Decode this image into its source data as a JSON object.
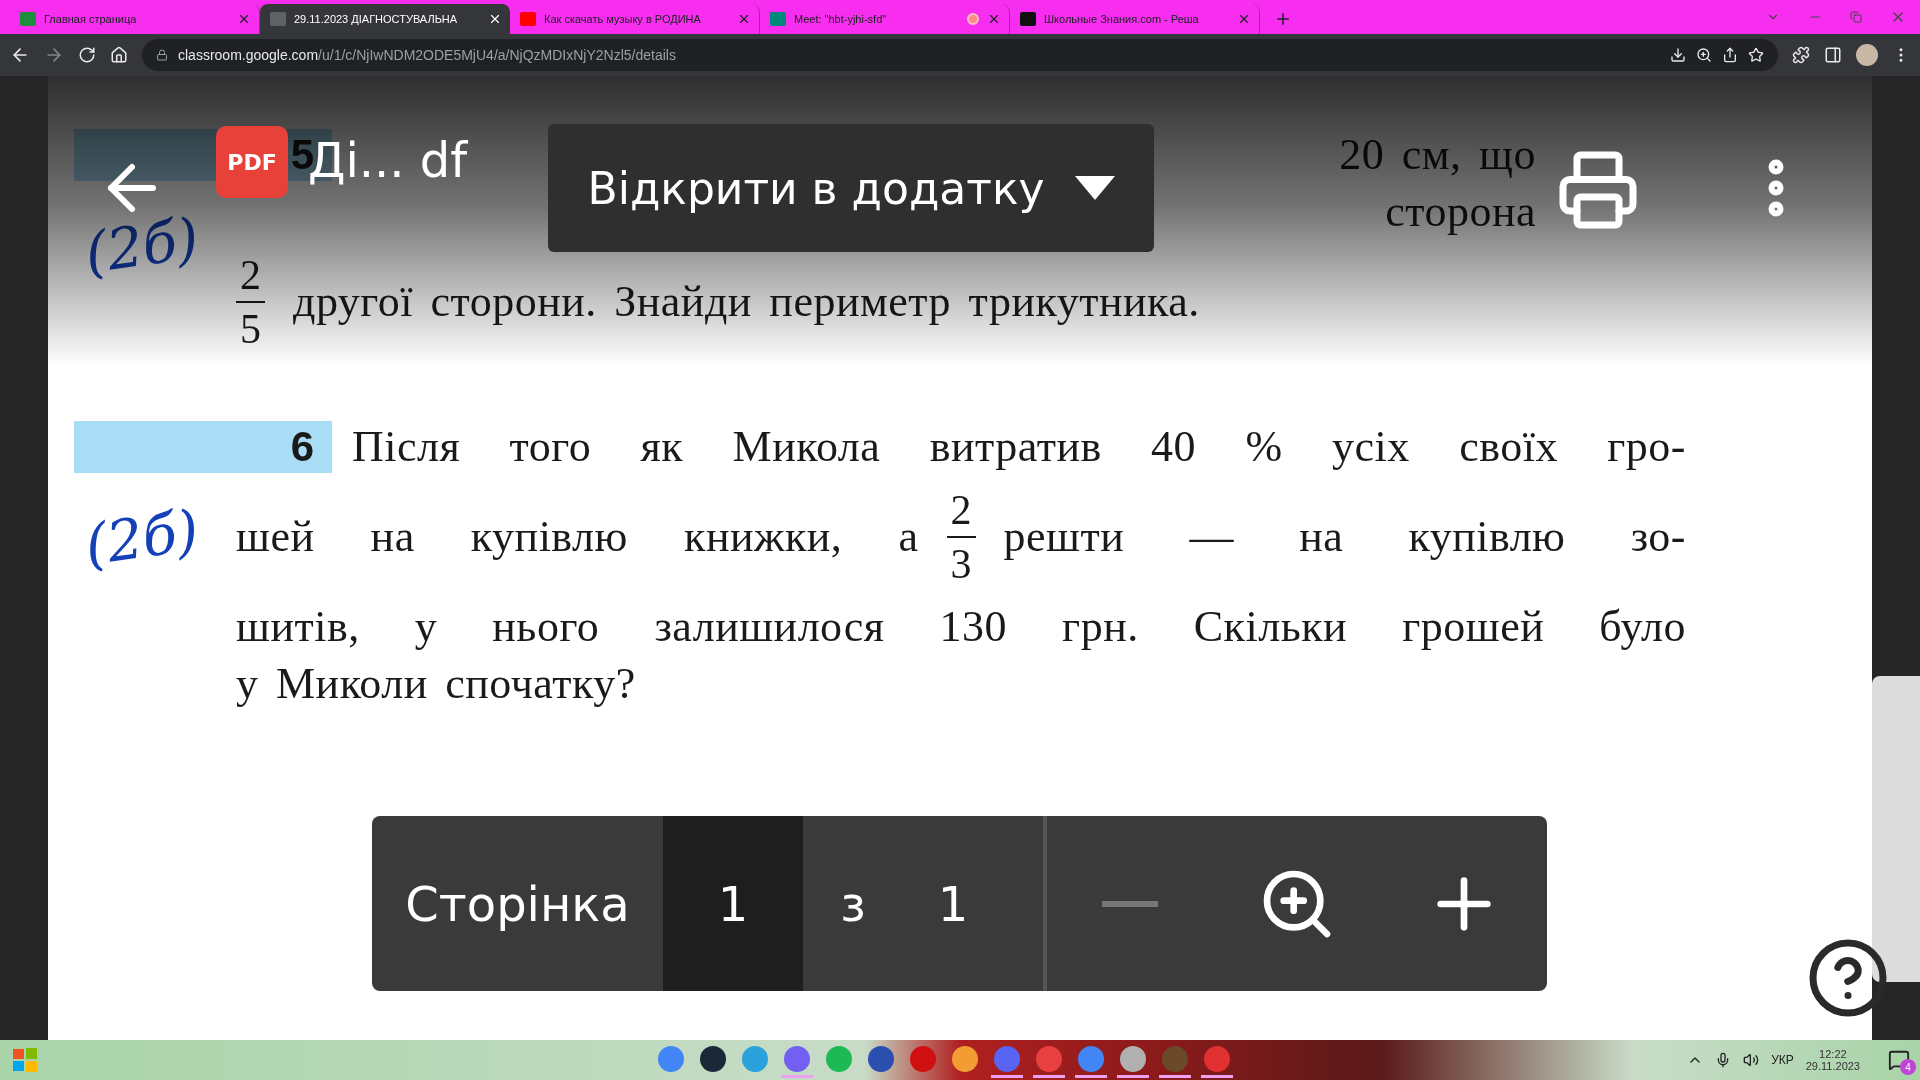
{
  "browser": {
    "tabs": [
      {
        "title": "Главная страница",
        "kind": "classroom",
        "selected": false,
        "recording": false
      },
      {
        "title": "29.11.2023 ДІАГНОСТУВАЛЬНА",
        "kind": "assignment",
        "selected": true,
        "recording": false
      },
      {
        "title": "Как скачать музыку в РОДИНА",
        "kind": "video",
        "selected": false,
        "recording": false
      },
      {
        "title": "Meet: \"hbt-yjhi-sfd\"",
        "kind": "meet",
        "selected": false,
        "recording": true
      },
      {
        "title": "Школьные Знания.com - Реша",
        "kind": "letter",
        "selected": false,
        "recording": false
      }
    ],
    "address": {
      "domain": "classroom.google.com",
      "path": "/u/1/c/NjIwNDM2ODE5MjU4/a/NjQzMDIxNjY2Nzl5/details"
    }
  },
  "viewer": {
    "file_badge": "PDF",
    "file_name": "Ді... df",
    "open_button": "Відкрити в додатку",
    "page_label": "Сторінка",
    "page_current": "1",
    "page_separator": "з",
    "page_total": "1"
  },
  "problems": [
    {
      "number": "5",
      "score_note": "(2б)",
      "lines": [
        [
          {
            "kind": "fragment",
            "text": "20 см, що"
          }
        ],
        [
          {
            "kind": "fragment",
            "text": "сторона"
          }
        ],
        [
          {
            "kind": "fraction",
            "num": "2",
            "den": "5"
          },
          {
            "kind": "text",
            "text": "другої сторони. Знайди периметр трикутника."
          }
        ]
      ]
    },
    {
      "number": "6",
      "score_note": "(2б)",
      "lines": [
        [
          {
            "kind": "text",
            "text": "Після того як Микола витратив 40 % усіх своїх гро-"
          }
        ],
        [
          {
            "kind": "text",
            "text": "шей на купівлю книжки, а"
          },
          {
            "kind": "fraction",
            "num": "2",
            "den": "3"
          },
          {
            "kind": "text",
            "text": "решти — на купівлю зо-"
          }
        ],
        [
          {
            "kind": "text",
            "text": "шитів, у нього залишилося 130 грн. Скільки грошей було"
          }
        ],
        [
          {
            "kind": "text",
            "text": "у Миколи спочатку?"
          }
        ]
      ]
    }
  ],
  "taskbar": {
    "apps": [
      {
        "kind": "chrome",
        "running": false
      },
      {
        "kind": "steam",
        "running": false
      },
      {
        "kind": "telegram",
        "running": false
      },
      {
        "kind": "viber",
        "running": true
      },
      {
        "kind": "spotify",
        "running": false
      },
      {
        "kind": "floppy",
        "running": false
      },
      {
        "kind": "player",
        "running": false
      },
      {
        "kind": "box",
        "running": false
      },
      {
        "kind": "discord",
        "running": true
      },
      {
        "kind": "sail",
        "running": true
      },
      {
        "kind": "chrome",
        "running": true
      },
      {
        "kind": "speaker",
        "running": true
      },
      {
        "kind": "portrait",
        "running": true
      },
      {
        "kind": "scissors",
        "running": true
      }
    ],
    "language": "УКР",
    "time": "12:22",
    "date": "29.11.2023",
    "notifications": "4"
  }
}
